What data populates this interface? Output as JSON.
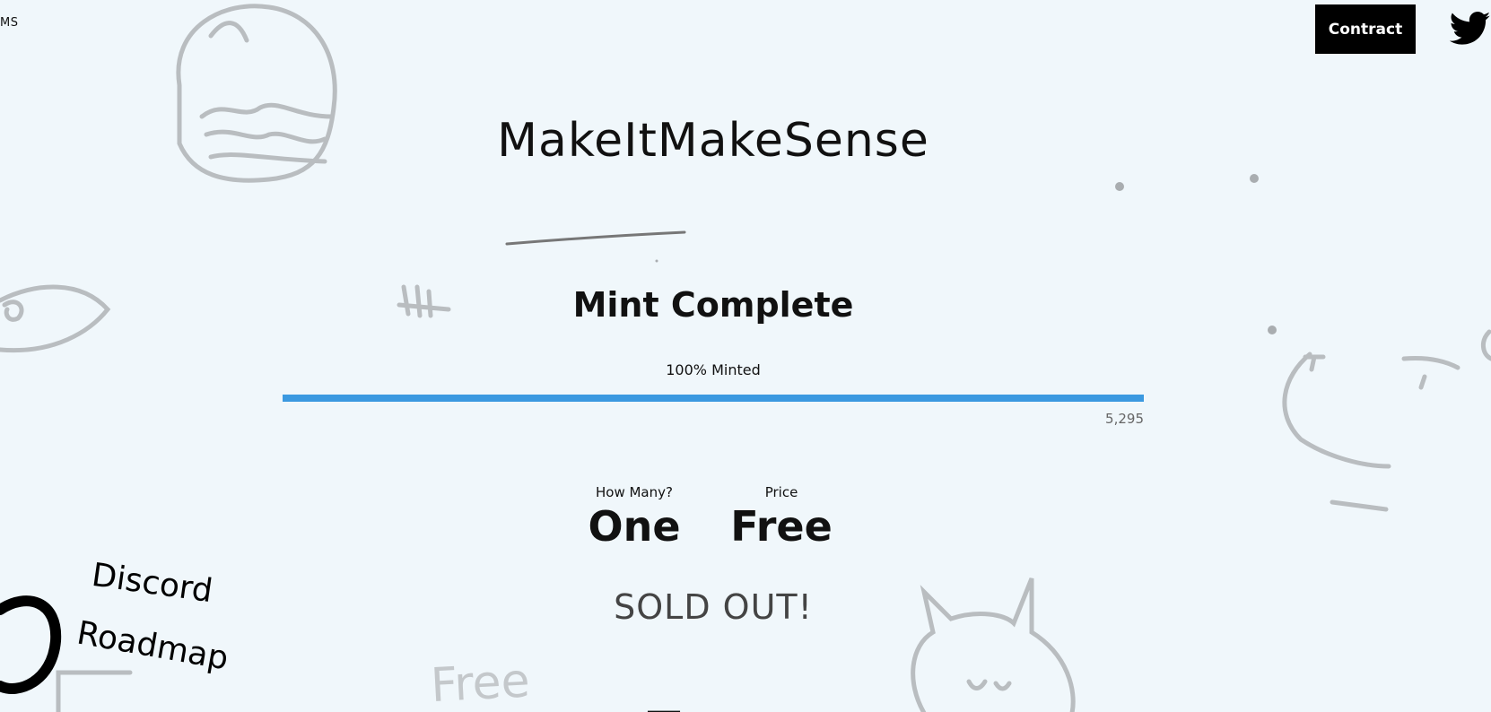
{
  "header": {
    "brand_short": "MS",
    "contract_label": "Contract",
    "twitter_icon": "twitter-icon"
  },
  "hero": {
    "title": "MakeItMakeSense",
    "status": "Mint Complete",
    "minted_label": "100% Minted",
    "minted_fraction": 1.0,
    "minted_count": "5,295"
  },
  "mint": {
    "quantity_label": "How Many?",
    "quantity_value": "One",
    "price_label": "Price",
    "price_value": "Free",
    "sold_out": "SOLD OUT!"
  },
  "nav": {
    "discord": "Discord",
    "roadmap": "Roadmap"
  },
  "doodles": {
    "free_text": "Free"
  },
  "colors": {
    "background": "#f0f7fb",
    "progress": "#3b99e0",
    "button_bg": "#000000",
    "doodle": "#b8bcbf"
  }
}
